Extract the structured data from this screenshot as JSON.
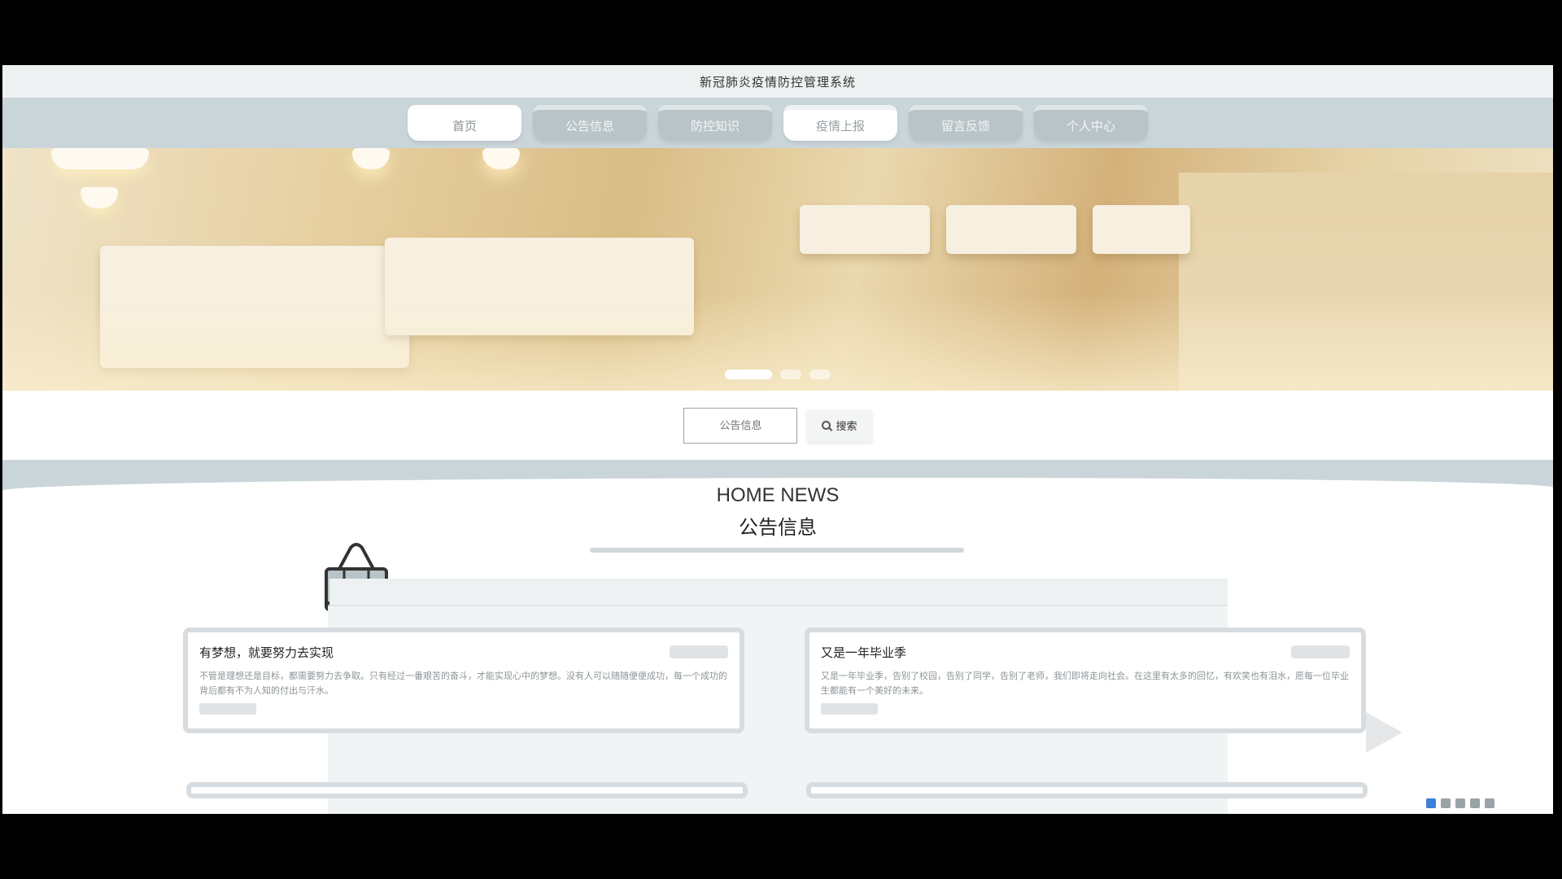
{
  "site": {
    "title": "新冠肺炎疫情防控管理系统"
  },
  "nav": {
    "items": [
      {
        "label": "首页",
        "state": "active"
      },
      {
        "label": "公告信息",
        "state": "normal"
      },
      {
        "label": "防控知识",
        "state": "normal"
      },
      {
        "label": "疫情上报",
        "state": "hover"
      },
      {
        "label": "留言反馈",
        "state": "normal"
      },
      {
        "label": "个人中心",
        "state": "normal"
      }
    ]
  },
  "banner": {
    "slides": 3,
    "active_slide": 1
  },
  "search": {
    "placeholder": "公告信息",
    "button_label": "搜索"
  },
  "news": {
    "title_en": "HOME NEWS",
    "title_cn": "公告信息",
    "cards": [
      {
        "title": "有梦想，就要努力去实现",
        "text": "不管是理想还是目标，都需要努力去争取。只有经过一番艰苦的奋斗，才能实现心中的梦想。没有人可以随随便便成功，每一个成功的背后都有不为人知的付出与汗水。"
      },
      {
        "title": "又是一年毕业季",
        "text": "又是一年毕业季，告别了校园，告别了同学，告别了老师，我们即将走向社会。在这里有太多的回忆，有欢笑也有泪水，愿每一位毕业生都能有一个美好的未来。"
      }
    ]
  },
  "colors": {
    "nav_bg": "#c9d5d9",
    "accent": "#ffffff",
    "text": "#333333"
  }
}
